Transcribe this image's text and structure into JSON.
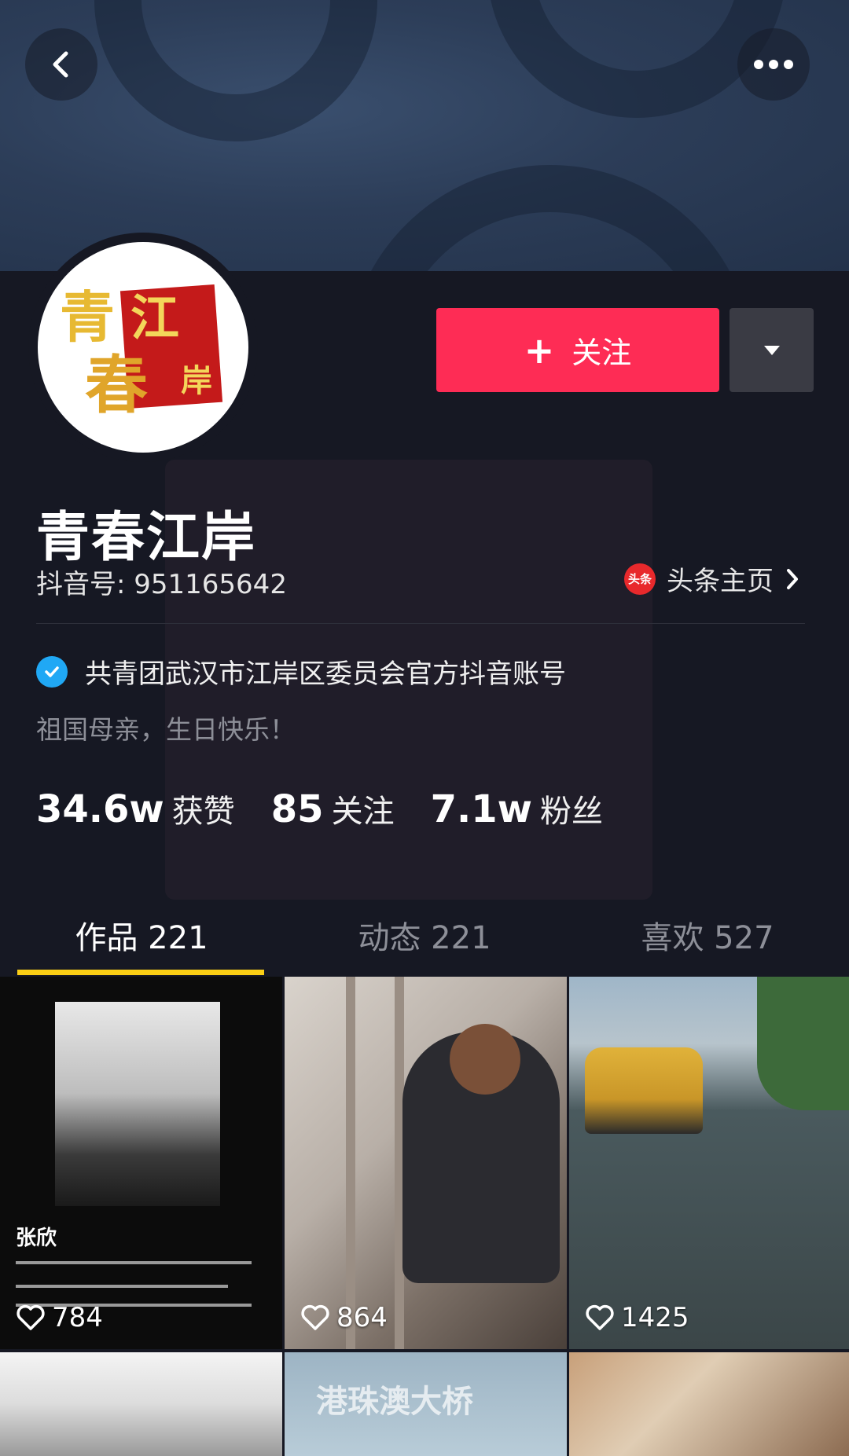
{
  "header": {
    "back_icon": "chevron-left-icon",
    "more_icon": "more-dots-icon"
  },
  "profile": {
    "avatar_text": "青江春岸",
    "follow_label": "关注",
    "nickname": "青春江岸",
    "douyin_id": "抖音号: 951165642",
    "toutiao_badge": "头条",
    "toutiao_link": "头条主页",
    "verified_text": "共青团武汉市江岸区委员会官方抖音账号",
    "signature": "祖国母亲，生日快乐！",
    "stats": [
      {
        "num": "34.6w",
        "label": "获赞"
      },
      {
        "num": "85",
        "label": "关注"
      },
      {
        "num": "7.1w",
        "label": "粉丝"
      }
    ]
  },
  "tabs": [
    {
      "label": "作品 221",
      "active": true
    },
    {
      "label": "动态 221",
      "active": false
    },
    {
      "label": "喜欢 527",
      "active": false
    }
  ],
  "videos": [
    {
      "likes": "784",
      "caption": "张欣"
    },
    {
      "likes": "864"
    },
    {
      "likes": "1425"
    },
    {
      "likes": ""
    },
    {
      "caption": "港珠澳大桥"
    },
    {
      "likes": ""
    }
  ],
  "colors": {
    "accent": "#fe2c55",
    "indicator": "#face15",
    "verified": "#20a8f5",
    "background": "#161823"
  }
}
